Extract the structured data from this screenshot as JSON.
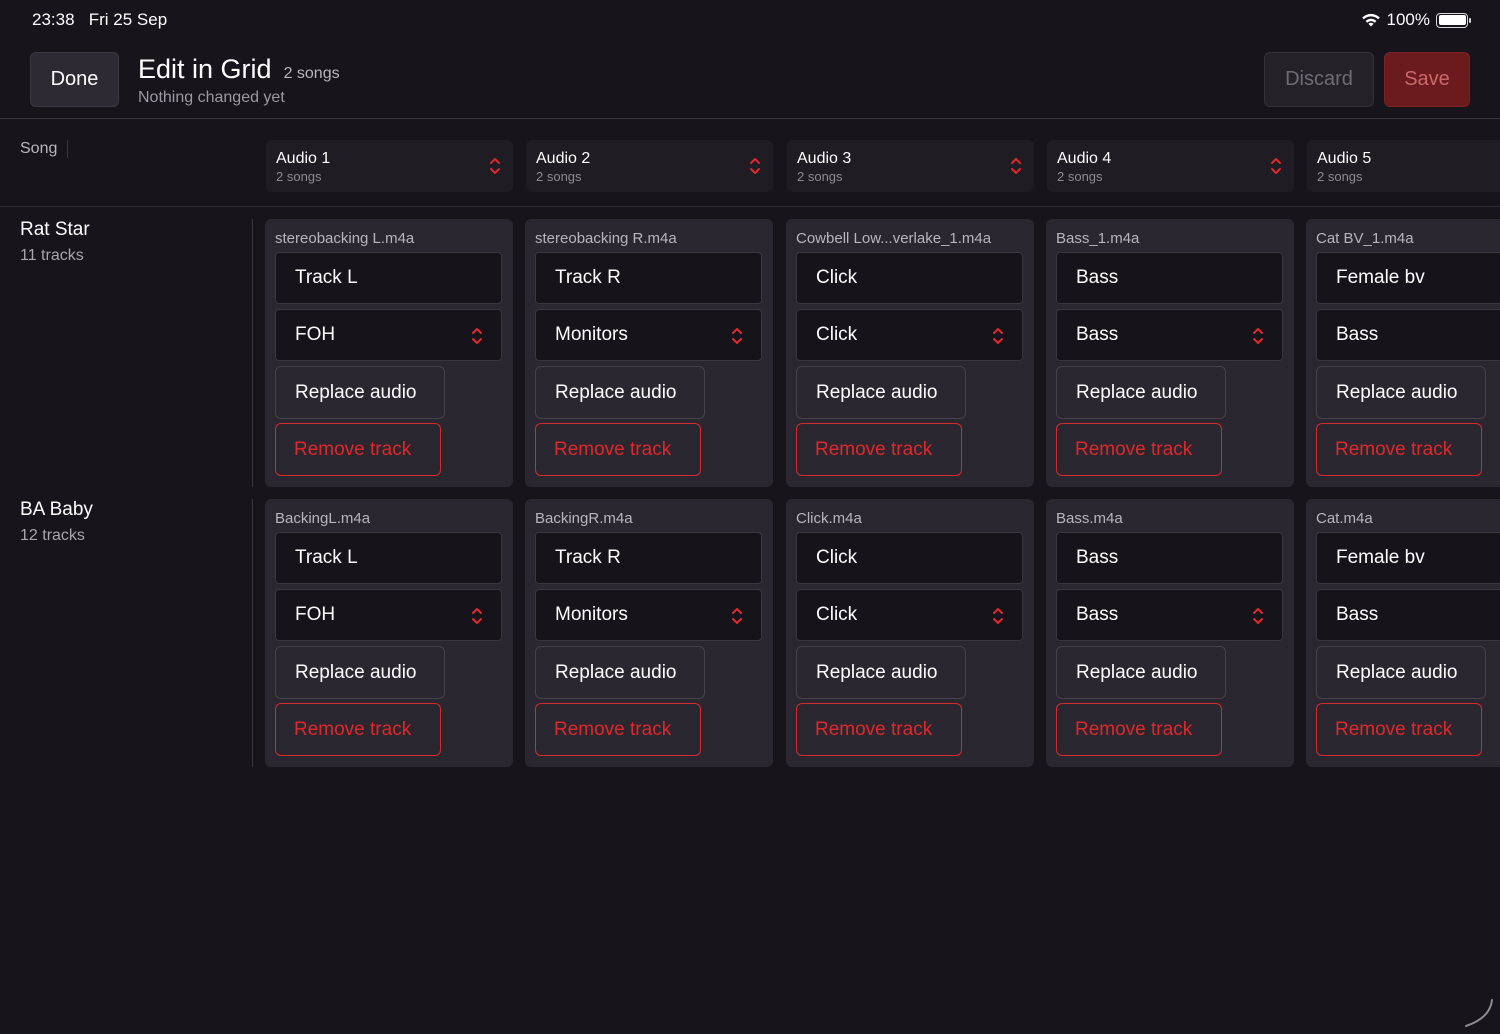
{
  "status": {
    "time": "23:38",
    "date": "Fri 25 Sep",
    "battery": "100%"
  },
  "header": {
    "done_label": "Done",
    "title": "Edit in Grid",
    "title_count": "2 songs",
    "subtitle": "Nothing changed yet",
    "discard_label": "Discard",
    "save_label": "Save"
  },
  "grid": {
    "song_header": "Song",
    "columns": [
      {
        "name": "Audio 1",
        "count": "2 songs"
      },
      {
        "name": "Audio 2",
        "count": "2 songs"
      },
      {
        "name": "Audio 3",
        "count": "2 songs"
      },
      {
        "name": "Audio 4",
        "count": "2 songs"
      },
      {
        "name": "Audio 5",
        "count": "2 songs"
      }
    ],
    "rows": [
      {
        "song": "Rat Star",
        "tracks": "11 tracks",
        "cells": [
          {
            "file": "stereobacking L.m4a",
            "track": "Track L",
            "route": "FOH",
            "replace": "Replace audio",
            "remove": "Remove track"
          },
          {
            "file": "stereobacking R.m4a",
            "track": "Track R",
            "route": "Monitors",
            "replace": "Replace audio",
            "remove": "Remove track"
          },
          {
            "file": "Cowbell Low...verlake_1.m4a",
            "track": "Click",
            "route": "Click",
            "replace": "Replace audio",
            "remove": "Remove track"
          },
          {
            "file": "Bass_1.m4a",
            "track": "Bass",
            "route": "Bass",
            "replace": "Replace audio",
            "remove": "Remove track"
          },
          {
            "file": "Cat BV_1.m4a",
            "track": "Female bv",
            "route": "Bass",
            "replace": "Replace audio",
            "remove": "Remove track"
          }
        ]
      },
      {
        "song": "BA Baby",
        "tracks": "12 tracks",
        "cells": [
          {
            "file": "BackingL.m4a",
            "track": "Track L",
            "route": "FOH",
            "replace": "Replace audio",
            "remove": "Remove track"
          },
          {
            "file": "BackingR.m4a",
            "track": "Track R",
            "route": "Monitors",
            "replace": "Replace audio",
            "remove": "Remove track"
          },
          {
            "file": "Click.m4a",
            "track": "Click",
            "route": "Click",
            "replace": "Replace audio",
            "remove": "Remove track"
          },
          {
            "file": "Bass.m4a",
            "track": "Bass",
            "route": "Bass",
            "replace": "Replace audio",
            "remove": "Remove track"
          },
          {
            "file": "Cat.m4a",
            "track": "Female bv",
            "route": "Bass",
            "replace": "Replace audio",
            "remove": "Remove track"
          }
        ]
      }
    ]
  },
  "colors": {
    "accent_red": "#e0282a",
    "save_bg": "#6b1b1e",
    "background": "#17141c"
  }
}
